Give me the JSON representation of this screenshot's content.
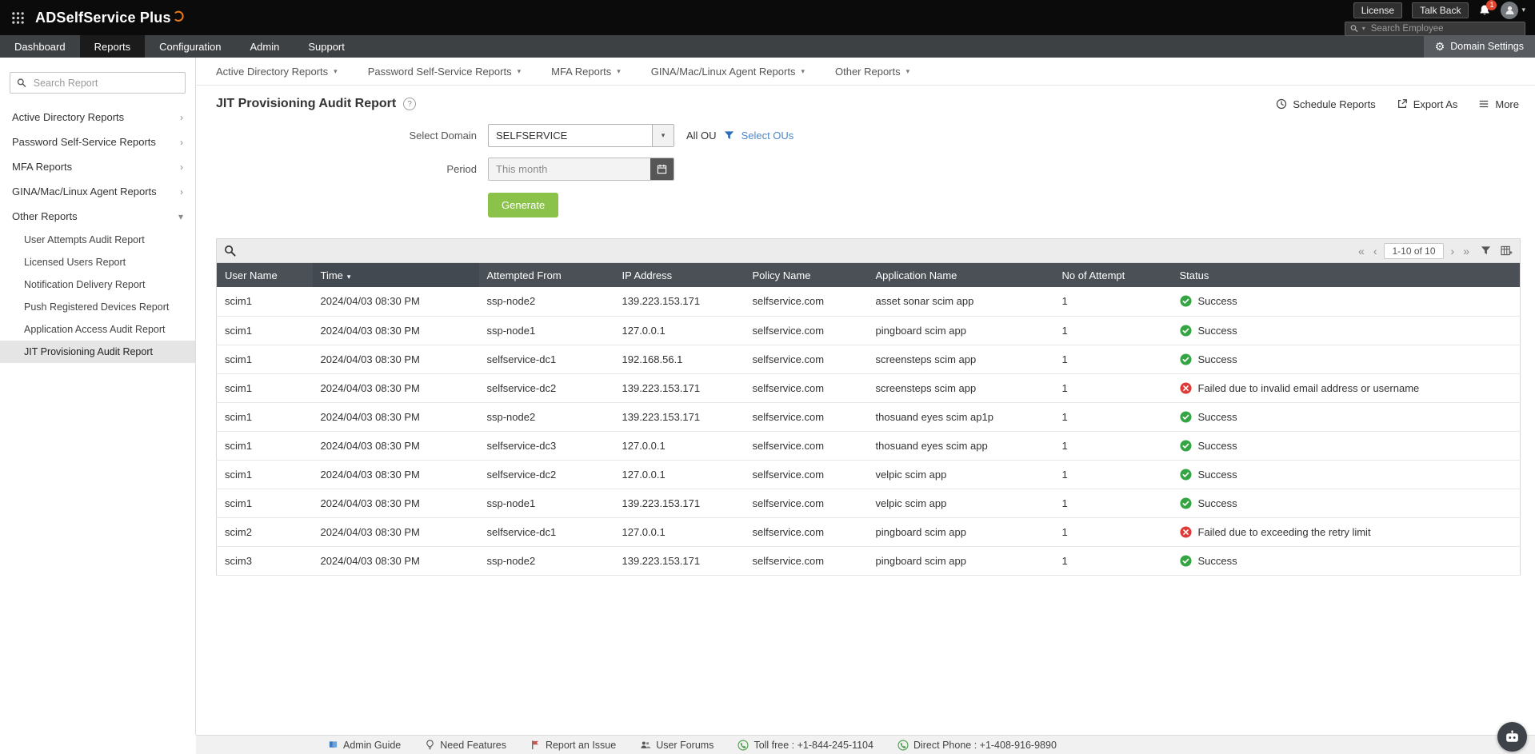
{
  "topbar": {
    "logo_text": "ADSelfService Plus",
    "license": "License",
    "talkback": "Talk Back",
    "notification_count": "1",
    "employee_search_placeholder": "Search Employee"
  },
  "mainnav": {
    "tabs": [
      {
        "label": "Dashboard",
        "active": false
      },
      {
        "label": "Reports",
        "active": true
      },
      {
        "label": "Configuration",
        "active": false
      },
      {
        "label": "Admin",
        "active": false
      },
      {
        "label": "Support",
        "active": false
      }
    ],
    "domain_settings": "Domain Settings"
  },
  "sidebar": {
    "search_placeholder": "Search Report",
    "groups": [
      {
        "label": "Active Directory Reports",
        "expanded": false
      },
      {
        "label": "Password Self-Service Reports",
        "expanded": false
      },
      {
        "label": "MFA Reports",
        "expanded": false
      },
      {
        "label": "GINA/Mac/Linux Agent Reports",
        "expanded": false
      },
      {
        "label": "Other Reports",
        "expanded": true
      }
    ],
    "other_report_items": [
      {
        "label": "User Attempts Audit Report",
        "selected": false
      },
      {
        "label": "Licensed Users Report",
        "selected": false
      },
      {
        "label": "Notification Delivery Report",
        "selected": false
      },
      {
        "label": "Push Registered Devices Report",
        "selected": false
      },
      {
        "label": "Application Access Audit Report",
        "selected": false
      },
      {
        "label": "JIT Provisioning Audit Report",
        "selected": true
      }
    ]
  },
  "report_nav": {
    "items": [
      "Active Directory Reports",
      "Password Self-Service Reports",
      "MFA Reports",
      "GINA/Mac/Linux Agent Reports",
      "Other Reports"
    ]
  },
  "page": {
    "title": "JIT Provisioning Audit Report",
    "actions": [
      {
        "label": "Schedule Reports"
      },
      {
        "label": "Export As"
      },
      {
        "label": "More"
      }
    ]
  },
  "form": {
    "domain_label": "Select Domain",
    "domain_value": "SELFSERVICE",
    "all_ou_label": "All OU",
    "select_ous_label": "Select OUs",
    "period_label": "Period",
    "period_value": "This month",
    "generate_label": "Generate"
  },
  "grid": {
    "pagination_text": "1-10 of 10",
    "columns": [
      "User Name",
      "Time",
      "Attempted From",
      "IP Address",
      "Policy Name",
      "Application Name",
      "No of Attempt",
      "Status"
    ],
    "rows": [
      {
        "user_name": "scim1",
        "time": "2024/04/03 08:30 PM",
        "attempted_from": "ssp-node2",
        "ip": "139.223.153.171",
        "policy": "selfservice.com",
        "application": "asset sonar scim app",
        "attempts": "1",
        "status": "Success",
        "success": true
      },
      {
        "user_name": "scim1",
        "time": "2024/04/03 08:30 PM",
        "attempted_from": "ssp-node1",
        "ip": "127.0.0.1",
        "policy": "selfservice.com",
        "application": "pingboard scim app",
        "attempts": "1",
        "status": "Success",
        "success": true
      },
      {
        "user_name": "scim1",
        "time": "2024/04/03 08:30 PM",
        "attempted_from": "selfservice-dc1",
        "ip": "192.168.56.1",
        "policy": "selfservice.com",
        "application": "screensteps scim app",
        "attempts": "1",
        "status": "Success",
        "success": true
      },
      {
        "user_name": "scim1",
        "time": "2024/04/03 08:30 PM",
        "attempted_from": "selfservice-dc2",
        "ip": "139.223.153.171",
        "policy": "selfservice.com",
        "application": "screensteps scim app",
        "attempts": "1",
        "status": "Failed due to invalid email address or username",
        "success": false
      },
      {
        "user_name": "scim1",
        "time": "2024/04/03 08:30 PM",
        "attempted_from": "ssp-node2",
        "ip": "139.223.153.171",
        "policy": "selfservice.com",
        "application": "thosuand eyes scim ap1p",
        "attempts": "1",
        "status": "Success",
        "success": true
      },
      {
        "user_name": "scim1",
        "time": "2024/04/03 08:30 PM",
        "attempted_from": "selfservice-dc3",
        "ip": "127.0.0.1",
        "policy": "selfservice.com",
        "application": "thosuand eyes scim app",
        "attempts": "1",
        "status": "Success",
        "success": true
      },
      {
        "user_name": "scim1",
        "time": "2024/04/03 08:30 PM",
        "attempted_from": "selfservice-dc2",
        "ip": "127.0.0.1",
        "policy": "selfservice.com",
        "application": "velpic scim app",
        "attempts": "1",
        "status": "Success",
        "success": true
      },
      {
        "user_name": "scim1",
        "time": "2024/04/03 08:30 PM",
        "attempted_from": "ssp-node1",
        "ip": "139.223.153.171",
        "policy": "selfservice.com",
        "application": "velpic scim app",
        "attempts": "1",
        "status": "Success",
        "success": true
      },
      {
        "user_name": "scim2",
        "time": "2024/04/03 08:30 PM",
        "attempted_from": "selfservice-dc1",
        "ip": "127.0.0.1",
        "policy": "selfservice.com",
        "application": "pingboard scim app",
        "attempts": "1",
        "status": "Failed due to exceeding the retry limit",
        "success": false
      },
      {
        "user_name": "scim3",
        "time": "2024/04/03 08:30 PM",
        "attempted_from": "ssp-node2",
        "ip": "139.223.153.171",
        "policy": "selfservice.com",
        "application": "pingboard scim app",
        "attempts": "1",
        "status": "Success",
        "success": true
      }
    ]
  },
  "footer": {
    "links": [
      "Admin Guide",
      "Need Features",
      "Report an Issue",
      "User Forums"
    ],
    "toll_free": "Toll free : +1-844-245-1104",
    "direct_phone": "Direct Phone : +1-408-916-9890"
  },
  "icons": {
    "caret_down": "▾",
    "chevron_right": "›",
    "first_page": "«",
    "prev_page": "‹",
    "next_page": "›",
    "last_page": "»",
    "gear": "⚙",
    "help": "?"
  },
  "colors": {
    "accent_green": "#8bc34a",
    "success_green": "#35a544",
    "error_red": "#dd3b37",
    "link_blue": "#4f86c6",
    "table_header": "#4a5056"
  }
}
